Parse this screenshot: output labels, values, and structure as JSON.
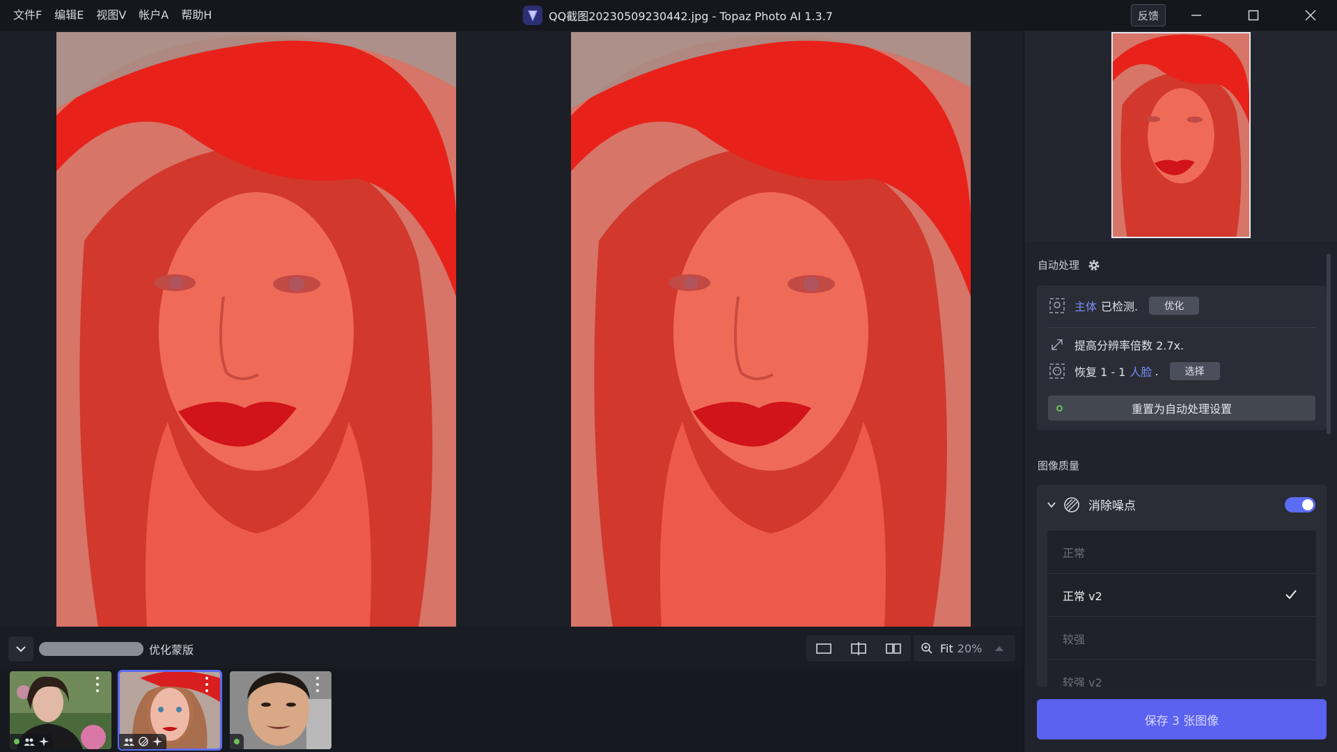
{
  "menu": [
    {
      "label": "文件F"
    },
    {
      "label": "编辑E"
    },
    {
      "label": "视图V"
    },
    {
      "label": "帐户A"
    },
    {
      "label": "帮助H"
    }
  ],
  "window": {
    "title": "QQ截图20230509230442.jpg - Topaz Photo AI 1.3.7",
    "feedback_label": "反馈"
  },
  "colors": {
    "accent": "#5b6cf5",
    "save_button": "#5b62f0",
    "panel_bg": "#20232b",
    "status_green": "#6ec05a"
  },
  "bottombar": {
    "mask_label": "优化蒙版",
    "zoom_label": "Fit",
    "zoom_value": "20%"
  },
  "filmstrip": {
    "thumbnails": [
      {
        "name": "photo-1",
        "selected": false
      },
      {
        "name": "photo-2",
        "selected": true
      },
      {
        "name": "photo-3",
        "selected": false
      }
    ]
  },
  "panel": {
    "auto_title": "自动处理",
    "subject_link": "主体",
    "subject_detected": "已检测.",
    "optimize_btn": "优化",
    "upscale_text": "提高分辨率倍数 2.7x.",
    "face_prefix": "恢复 1 - 1",
    "face_link": "人脸",
    "face_suffix": ".",
    "select_btn": "选择",
    "reset_btn": "重置为自动处理设置",
    "quality_title": "图像质量",
    "denoise_title": "消除噪点",
    "denoise_enabled": true,
    "models": [
      {
        "label": "正常",
        "active": false
      },
      {
        "label": "正常 v2",
        "active": true
      },
      {
        "label": "较强",
        "active": false
      },
      {
        "label": "较强 v2",
        "active": false
      }
    ],
    "save_btn": "保存 3 张图像"
  }
}
